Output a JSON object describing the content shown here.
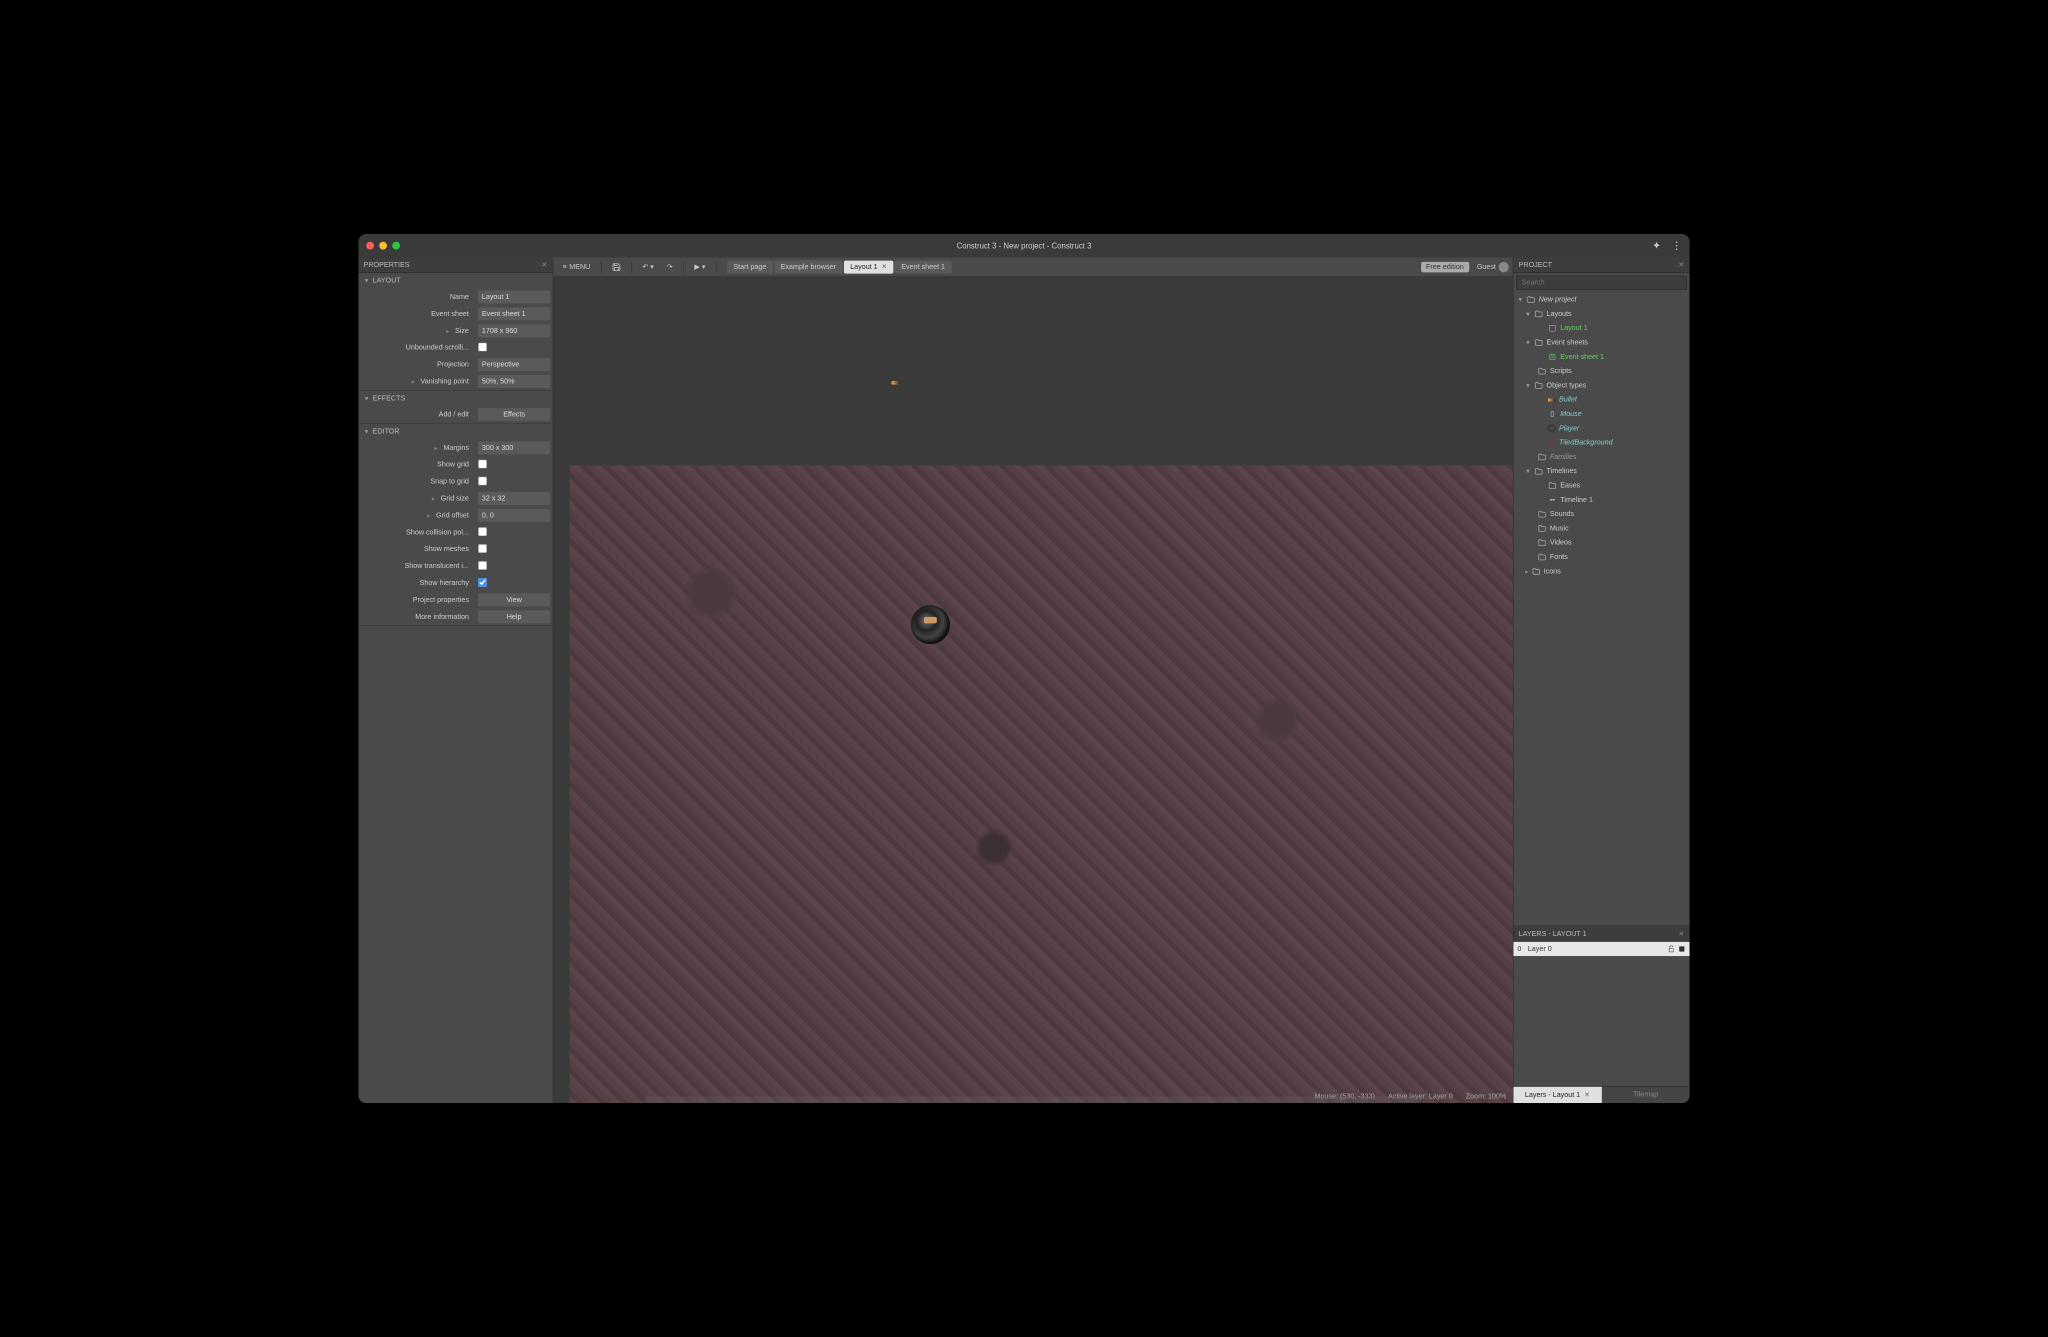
{
  "title": "Construct 3 - New project - Construct 3",
  "toolbar": {
    "menu": "MENU",
    "freeEdition": "Free edition",
    "guest": "Guest"
  },
  "tabs": {
    "start": "Start page",
    "examples": "Example browser",
    "layout": "Layout 1",
    "event": "Event sheet 1"
  },
  "propertiesPanel": {
    "title": "PROPERTIES",
    "sections": {
      "layout": "LAYOUT",
      "effects": "EFFECTS",
      "editor": "EDITOR"
    },
    "labels": {
      "name": "Name",
      "eventSheet": "Event sheet",
      "size": "Size",
      "unbounded": "Unbounded scrolli...",
      "projection": "Projection",
      "vanishing": "Vanishing point",
      "addEdit": "Add / edit",
      "margins": "Margins",
      "showGrid": "Show grid",
      "snapGrid": "Snap to grid",
      "gridSize": "Grid size",
      "gridOffset": "Grid offset",
      "showCollision": "Show collision pol...",
      "showMeshes": "Show meshes",
      "showTranslucent": "Show translucent i...",
      "showHierarchy": "Show hierarchy",
      "projectProps": "Project properties",
      "moreInfo": "More information"
    },
    "values": {
      "name": "Layout 1",
      "eventSheet": "Event sheet 1",
      "size": "1708 x 960",
      "projection": "Perspective",
      "vanishing": "50%, 50%",
      "effectsBtn": "Effects",
      "margins": "300 x 300",
      "gridSize": "32 x 32",
      "gridOffset": "0, 0",
      "viewBtn": "View",
      "helpBtn": "Help"
    }
  },
  "status": {
    "mouse": "Mouse: (530, -333)",
    "activeLayer": "Active layer: Layer 0",
    "zoom": "Zoom: 100%"
  },
  "projectPanel": {
    "title": "PROJECT",
    "searchPlaceholder": "Search",
    "tree": {
      "root": "New project",
      "layouts": "Layouts",
      "layout1": "Layout 1",
      "eventSheets": "Event sheets",
      "eventSheet1": "Event sheet 1",
      "scripts": "Scripts",
      "objectTypes": "Object types",
      "bullet": "Bullet",
      "mouse": "Mouse",
      "player": "Player",
      "tiledBg": "TiledBackground",
      "families": "Families",
      "timelines": "Timelines",
      "eases": "Eases",
      "timeline1": "Timeline 1",
      "sounds": "Sounds",
      "music": "Music",
      "videos": "Videos",
      "fonts": "Fonts",
      "icons": "Icons"
    }
  },
  "layersPanel": {
    "title": "LAYERS - LAYOUT 1",
    "layer0num": "0",
    "layer0name": "Layer 0"
  },
  "bottomTabs": {
    "layers": "Layers - Layout 1",
    "tilemap": "Tilemap"
  }
}
